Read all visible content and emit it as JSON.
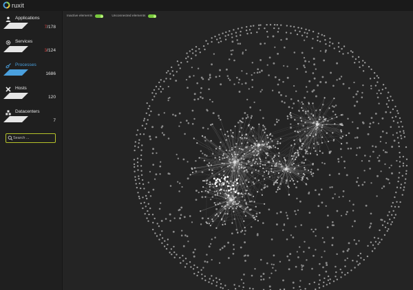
{
  "app": {
    "brand_name": "ruxit"
  },
  "colors": {
    "accent_blue": "#4aa0de",
    "problem_red": "#e04040",
    "toggle_on": "#79c93f",
    "search_border": "#b7c42a",
    "node": "#9a9a9a"
  },
  "sidebar": {
    "items": [
      {
        "label": "Applications",
        "problem_count": "7",
        "total": "/178",
        "icon": "user-icon",
        "active": false
      },
      {
        "label": "Services",
        "problem_count": "3",
        "total": "/124",
        "icon": "gear-icon",
        "active": false
      },
      {
        "label": "Processes",
        "problem_count": "",
        "total": "1686",
        "icon": "process-icon",
        "active": true
      },
      {
        "label": "Hosts",
        "problem_count": "",
        "total": "120",
        "icon": "host-icon",
        "active": false
      },
      {
        "label": "Datacenters",
        "problem_count": "",
        "total": "7",
        "icon": "datacenter-icon",
        "active": false
      }
    ]
  },
  "search": {
    "placeholder": "Search ...",
    "value": ""
  },
  "filters": [
    {
      "label": "Inactive elements",
      "enabled": true
    },
    {
      "label": "Unconnected elements",
      "enabled": true
    }
  ]
}
